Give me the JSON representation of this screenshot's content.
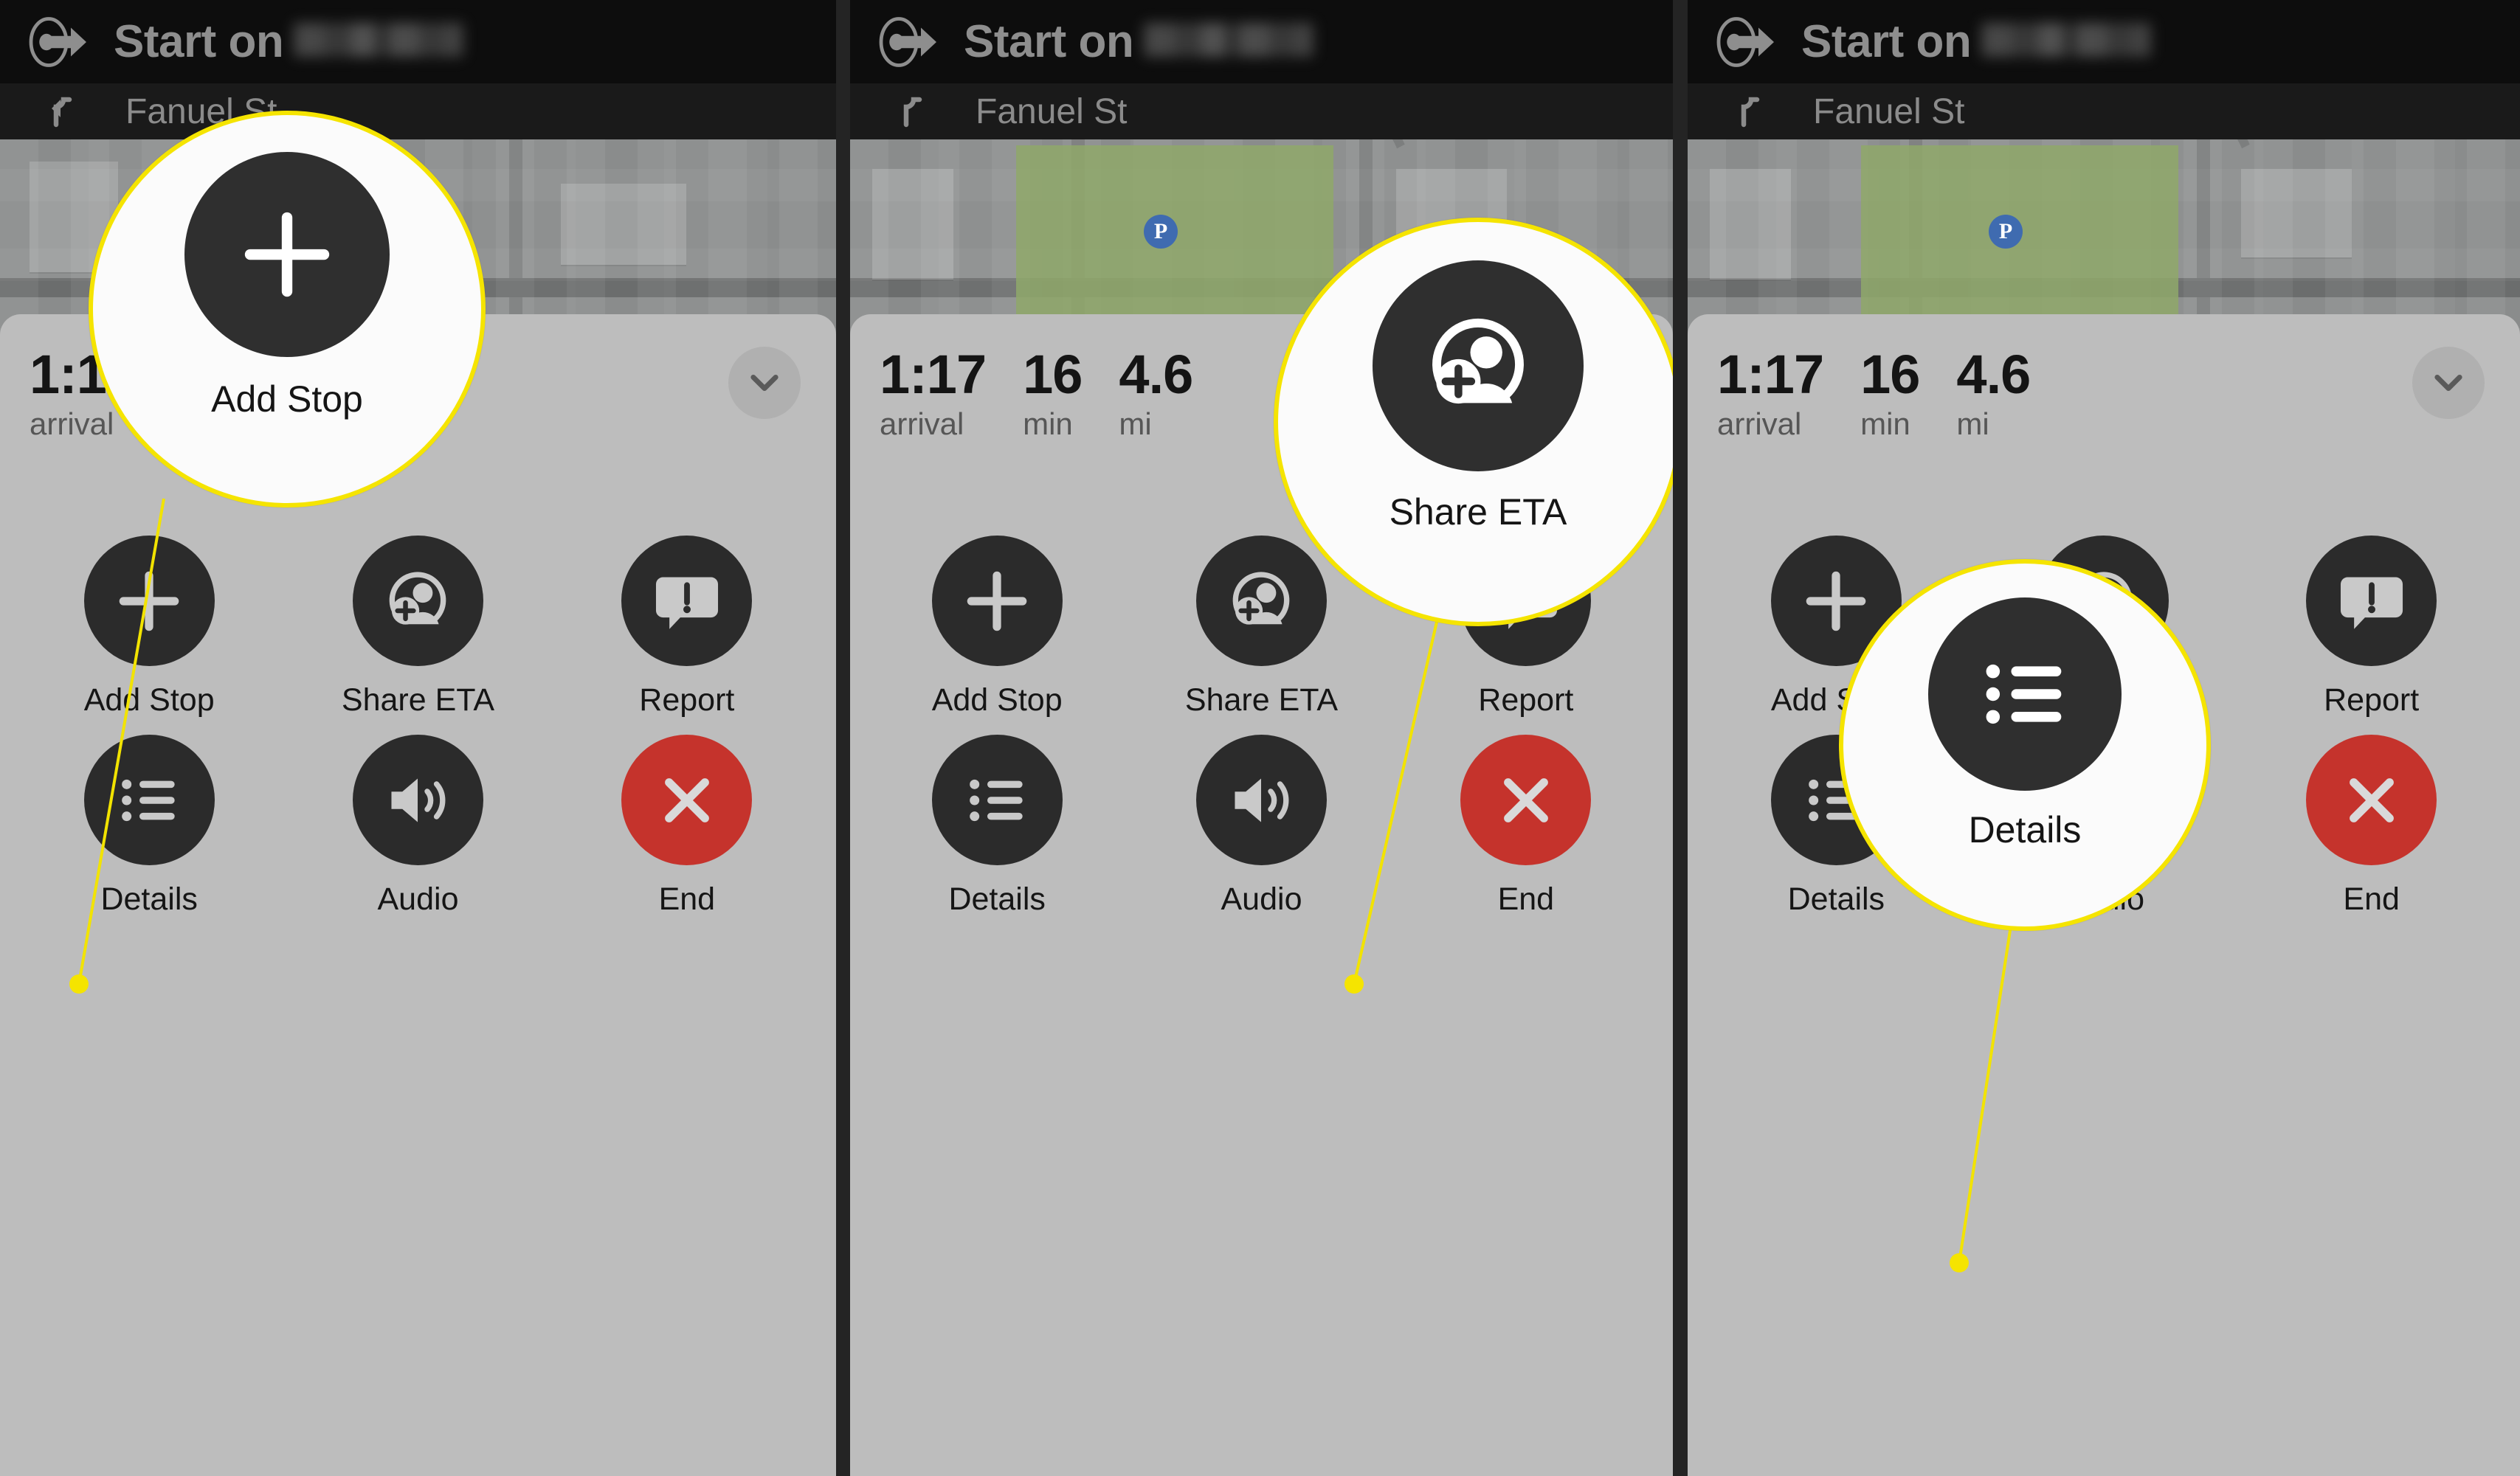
{
  "meta": {
    "accent_yellow": "#f5e400",
    "dark_circle": "#2b2b2b",
    "danger_red": "#c5332c",
    "sheet_bg": "#bdbdbd",
    "header_bg": "#0d0d0d"
  },
  "header": {
    "title_prefix": "Start on",
    "street_redacted": true,
    "depart_icon": "depart-arrow-icon"
  },
  "sub_step": {
    "street": "Fanuel St",
    "turn_icon": "turn-left-icon"
  },
  "eta": {
    "metrics": [
      {
        "value": "1:17",
        "label": "arrival"
      },
      {
        "value": "16",
        "label": "min"
      },
      {
        "value": "4.6",
        "label": "mi"
      }
    ],
    "collapse_icon": "chevron-down-icon"
  },
  "actions": [
    {
      "label": "Add Stop",
      "icon": "plus-icon"
    },
    {
      "label": "Share ETA",
      "icon": "person-add-icon"
    },
    {
      "label": "Report",
      "icon": "speech-bubble-exclamation-icon"
    },
    {
      "label": "Details",
      "icon": "list-icon"
    },
    {
      "label": "Audio",
      "icon": "speaker-waves-icon"
    },
    {
      "label": "End",
      "icon": "close-x-icon"
    }
  ],
  "callouts": [
    {
      "label": "Add Stop",
      "icon": "plus-icon"
    },
    {
      "label": "Share ETA",
      "icon": "person-add-icon"
    },
    {
      "label": "Details",
      "icon": "list-icon"
    }
  ],
  "map": {
    "parking_marker": "P"
  }
}
